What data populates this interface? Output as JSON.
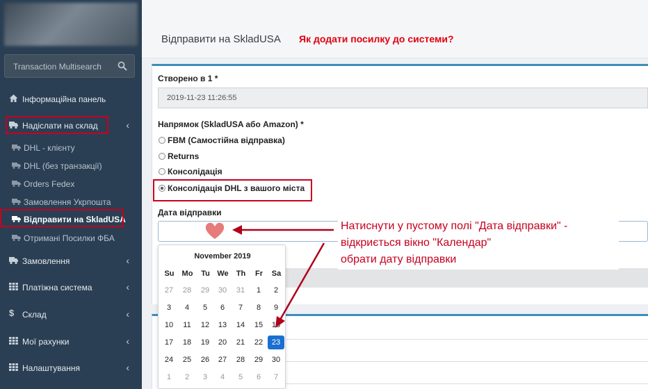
{
  "sidebar": {
    "search_placeholder": "Transaction Multisearch",
    "items": [
      {
        "label": "Інформаційна панель",
        "icon": "home-icon"
      },
      {
        "label": "Надіслати на склад",
        "icon": "truck-icon"
      },
      {
        "label": "Замовлення",
        "icon": "truck-icon"
      },
      {
        "label": "Платіжна система",
        "icon": "grid-icon"
      },
      {
        "label": "Склад",
        "icon": "dollar-icon"
      },
      {
        "label": "Мої рахунки",
        "icon": "grid-icon"
      },
      {
        "label": "Налаштування",
        "icon": "grid-icon"
      }
    ],
    "subitems": [
      {
        "label": "DHL - клієнту"
      },
      {
        "label": "DHL (без транзакції)"
      },
      {
        "label": "Orders Fedex"
      },
      {
        "label": "Замовлення Укрпошта"
      },
      {
        "label": "Відправити на SkladUSA"
      },
      {
        "label": "Отримані Посилки ФБА"
      }
    ]
  },
  "header": {
    "title": "Відправити на SkladUSA",
    "help_link": "Як додати посилку до системи?"
  },
  "form": {
    "created_label": "Створено в 1 *",
    "created_value": "2019-11-23 11:26:55",
    "direction_label": "Напрямок (SkladUSA або Amazon) *",
    "options": [
      "FBM (Самостійна відправка)",
      "Returns",
      "Консолідація",
      "Консолідація DHL з вашого міста"
    ],
    "selected_option": 3,
    "send_date_label": "Дата відправки"
  },
  "calendar": {
    "title": "November 2019",
    "weekdays": [
      "Su",
      "Mo",
      "Tu",
      "We",
      "Th",
      "Fr",
      "Sa"
    ],
    "weeks": [
      [
        "27",
        "28",
        "29",
        "30",
        "31",
        "1",
        "2"
      ],
      [
        "3",
        "4",
        "5",
        "6",
        "7",
        "8",
        "9"
      ],
      [
        "10",
        "11",
        "12",
        "13",
        "14",
        "15",
        "16"
      ],
      [
        "17",
        "18",
        "19",
        "20",
        "21",
        "22",
        "23"
      ],
      [
        "24",
        "25",
        "26",
        "27",
        "28",
        "29",
        "30"
      ],
      [
        "1",
        "2",
        "3",
        "4",
        "5",
        "6",
        "7"
      ]
    ],
    "selected_day": "23"
  },
  "annotation": {
    "line1": "Натиснути у пустому полі \"Дата відправки\" -",
    "line2": "відкриється вікно \"Календар\"",
    "line3": "обрати дату відправки",
    "color": "#c5001d"
  },
  "colors": {
    "sidebar": "#2a3f54",
    "accent": "#3c8dbc",
    "highlight": "#c9001e",
    "selected_day": "#1a6fd0"
  }
}
